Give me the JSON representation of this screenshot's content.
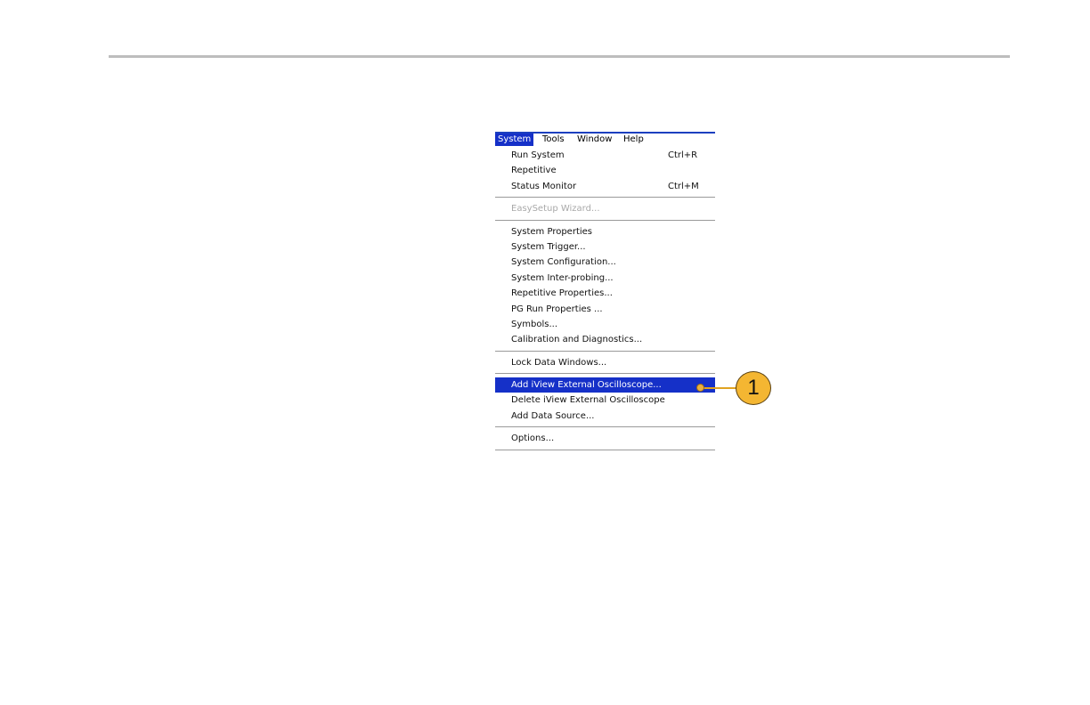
{
  "menubar": {
    "items": [
      "System",
      "Tools",
      "Window",
      "Help"
    ],
    "active": "System"
  },
  "menu": {
    "group1": [
      {
        "label": "Run System",
        "shortcut": "Ctrl+R"
      },
      {
        "label": "Repetitive",
        "shortcut": ""
      },
      {
        "label": "Status Monitor",
        "shortcut": "Ctrl+M"
      }
    ],
    "group2": [
      {
        "label": "EasySetup Wizard...",
        "disabled": true
      }
    ],
    "group3": [
      {
        "label": "System Properties"
      },
      {
        "label": "System Trigger..."
      },
      {
        "label": "System Configuration..."
      },
      {
        "label": "System Inter-probing..."
      },
      {
        "label": "Repetitive Properties..."
      },
      {
        "label": "PG Run Properties ..."
      },
      {
        "label": "Symbols..."
      },
      {
        "label": "Calibration and Diagnostics..."
      }
    ],
    "group4": [
      {
        "label": "Lock Data Windows..."
      }
    ],
    "group5": [
      {
        "label": "Add iView External Oscilloscope...",
        "highlighted": true
      },
      {
        "label": "Delete iView External Oscilloscope"
      },
      {
        "label": "Add Data Source..."
      }
    ],
    "group6": [
      {
        "label": "Options..."
      }
    ]
  },
  "callout": {
    "number": "1",
    "color": "#f4b632"
  },
  "colors": {
    "highlight": "#1530c8",
    "rule": "#bdbdbd"
  }
}
